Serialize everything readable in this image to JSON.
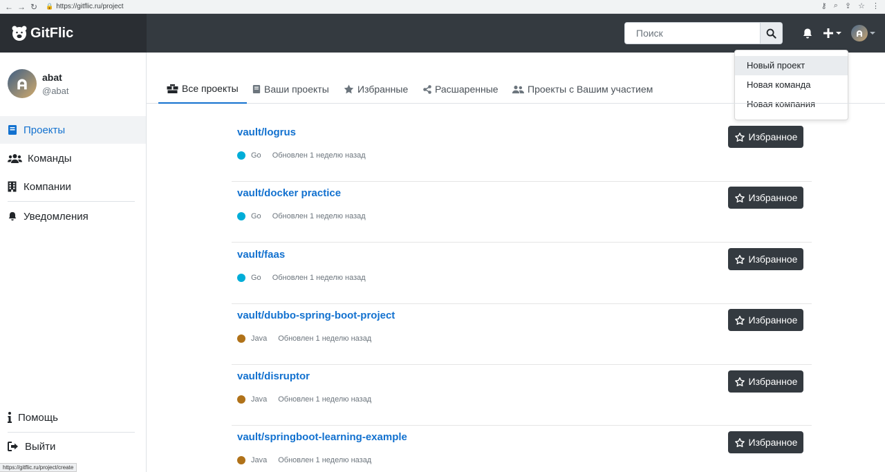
{
  "browser": {
    "url": "https://gitflic.ru/project"
  },
  "brand": {
    "name": "GitFlic"
  },
  "search": {
    "placeholder": "Поиск"
  },
  "dropdown": {
    "items": [
      "Новый проект",
      "Новая команда",
      "Новая компания"
    ]
  },
  "user": {
    "name": "abat",
    "handle": "@abat"
  },
  "sidebar": {
    "items": [
      {
        "label": "Проекты",
        "icon": "book-icon"
      },
      {
        "label": "Команды",
        "icon": "users-icon"
      },
      {
        "label": "Компании",
        "icon": "building-icon"
      },
      {
        "label": "Уведомления",
        "icon": "bell-icon"
      }
    ],
    "bottom": [
      {
        "label": "Помощь",
        "icon": "info-icon"
      },
      {
        "label": "Выйти",
        "icon": "sign-out-icon"
      }
    ]
  },
  "tabs": [
    {
      "label": "Все проекты",
      "icon": "boxes-icon"
    },
    {
      "label": "Ваши проекты",
      "icon": "book-icon"
    },
    {
      "label": "Избранные",
      "icon": "star-icon"
    },
    {
      "label": "Расшаренные",
      "icon": "share-icon"
    },
    {
      "label": "Проекты с Вашим участием",
      "icon": "users-icon"
    }
  ],
  "projects": [
    {
      "name": "vault/logrus",
      "lang": "Go",
      "lang_color": "#00add8",
      "updated": "Обновлен 1 неделю назад",
      "fav_label": "Избранное"
    },
    {
      "name": "vault/docker practice",
      "lang": "Go",
      "lang_color": "#00add8",
      "updated": "Обновлен 1 неделю назад",
      "fav_label": "Избранное"
    },
    {
      "name": "vault/faas",
      "lang": "Go",
      "lang_color": "#00add8",
      "updated": "Обновлен 1 неделю назад",
      "fav_label": "Избранное"
    },
    {
      "name": "vault/dubbo-spring-boot-project",
      "lang": "Java",
      "lang_color": "#b07219",
      "updated": "Обновлен 1 неделю назад",
      "fav_label": "Избранное"
    },
    {
      "name": "vault/disruptor",
      "lang": "Java",
      "lang_color": "#b07219",
      "updated": "Обновлен 1 неделю назад",
      "fav_label": "Избранное"
    },
    {
      "name": "vault/springboot-learning-example",
      "lang": "Java",
      "lang_color": "#b07219",
      "updated": "Обновлен 1 неделю назад",
      "fav_label": "Избранное"
    }
  ],
  "status_bar": {
    "url": "https://gitflic.ru/project/create"
  }
}
